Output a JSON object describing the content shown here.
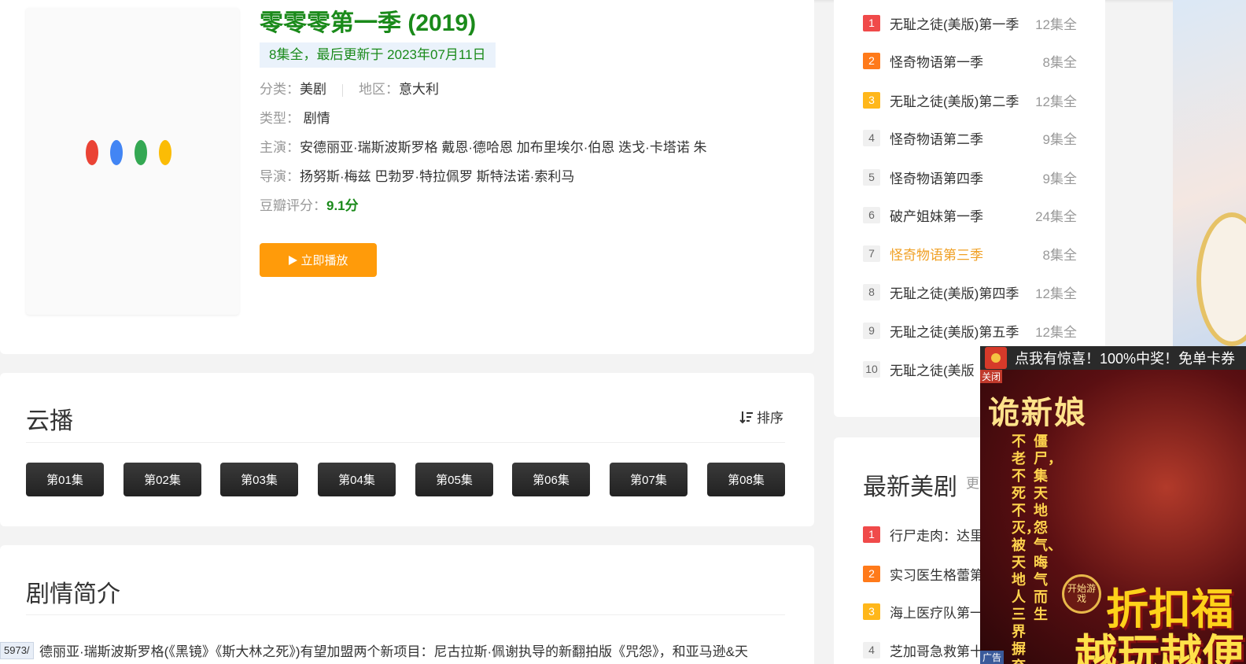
{
  "show": {
    "title": "零零零第一季 (2019)",
    "update": "8集全，最后更新于 2023年07月11日",
    "category_key": "分类：",
    "category": "美剧",
    "region_key": "地区：",
    "region": "意大利",
    "genre_key": "类型：",
    "genre": "剧情",
    "cast_key": "主演：",
    "cast": "安德丽亚·瑞斯波斯罗格 戴恩·德哈恩 加布里埃尔·伯恩 迭戈·卡塔诺 朱",
    "director_key": "导演：",
    "director": "扬努斯·梅兹 巴勃罗·特拉佩罗 斯特法诺·索利马",
    "rating_key": "豆瓣评分：",
    "rating": "9.1分",
    "play_label": "立即播放",
    "play_icon": "play-icon",
    "loading_colors": [
      "#ea4335",
      "#4285f4",
      "#34a853",
      "#fbbc05"
    ]
  },
  "cloud": {
    "title": "云播",
    "sort_label": "排序",
    "sort_icon": "sort-icon",
    "episodes": [
      "第01集",
      "第02集",
      "第03集",
      "第04集",
      "第05集",
      "第06集",
      "第07集",
      "第08集"
    ]
  },
  "synopsis": {
    "title": "剧情简介",
    "text": "德丽亚·瑞斯波斯罗格(《黑镜》《斯大林之死》)有望加盟两个新项目：尼古拉斯·佩谢执导的新翻拍版《咒怨》，和亚马逊&天",
    "status_url": "5973/"
  },
  "ranking": {
    "items": [
      {
        "num": "1",
        "name": "无耻之徒(美版)第一季",
        "count": "12集全"
      },
      {
        "num": "2",
        "name": "怪奇物语第一季",
        "count": "8集全"
      },
      {
        "num": "3",
        "name": "无耻之徒(美版)第二季",
        "count": "12集全"
      },
      {
        "num": "4",
        "name": "怪奇物语第二季",
        "count": "9集全"
      },
      {
        "num": "5",
        "name": "怪奇物语第四季",
        "count": "9集全"
      },
      {
        "num": "6",
        "name": "破产姐妹第一季",
        "count": "24集全"
      },
      {
        "num": "7",
        "name": "怪奇物语第三季",
        "count": "8集全"
      },
      {
        "num": "8",
        "name": "无耻之徒(美版)第四季",
        "count": "12集全"
      },
      {
        "num": "9",
        "name": "无耻之徒(美版)第五季",
        "count": "12集全"
      },
      {
        "num": "10",
        "name": "无耻之徒(美版",
        "count": ""
      }
    ]
  },
  "latest": {
    "title": "最新美剧",
    "more": "更",
    "items": [
      {
        "num": "1",
        "name": "行尸走肉：达里"
      },
      {
        "num": "2",
        "name": "实习医生格蕾第"
      },
      {
        "num": "3",
        "name": "海上医疗队第一"
      },
      {
        "num": "4",
        "name": "芝加哥急救第十"
      }
    ]
  },
  "ad": {
    "bar_text": "点我有惊喜！100%中奖！免单卡券",
    "close_label": "关闭",
    "title": "诡新娘",
    "col1": "僵尸，集天地怨气、晦气而生",
    "col2": "不老不死不灭，被天地人三界摒弃",
    "badge": "开始游戏",
    "big1": "折扣福",
    "big2": "越玩越便",
    "tag": "广告"
  },
  "colors": {
    "green": "#1a8a1a",
    "orange": "#ff9b0a",
    "active": "#f0a024"
  }
}
